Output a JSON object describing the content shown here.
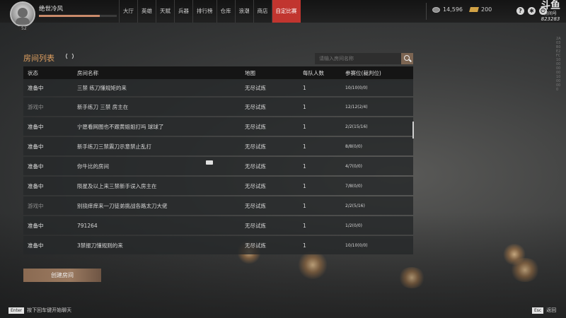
{
  "player": {
    "name": "绝世冷风",
    "level": "52",
    "hp_fraction": 0.78
  },
  "nav": [
    {
      "label": "大厅",
      "active": false
    },
    {
      "label": "英雄",
      "active": false
    },
    {
      "label": "天赋",
      "active": false
    },
    {
      "label": "兵器",
      "active": false
    },
    {
      "label": "排行榜",
      "active": false
    },
    {
      "label": "仓库",
      "active": false
    },
    {
      "label": "浪潮",
      "active": false
    },
    {
      "label": "商店",
      "active": false
    },
    {
      "label": "自定比赛",
      "active": true
    }
  ],
  "currency": {
    "silver": "14,596",
    "gold": "200"
  },
  "top_icons": [
    "help-icon",
    "settings-icon",
    "power-icon"
  ],
  "stream": {
    "logo": "斗鱼",
    "subtitle": "房间号",
    "room_id": "823283",
    "vertical_id": "2A03B0E2FC100000001000000"
  },
  "panel": {
    "title": "房间列表",
    "search_placeholder": "请输入房间名称",
    "columns": [
      "状态",
      "房间名称",
      "地图",
      "每队人数",
      "参赛位(裁判位)"
    ]
  },
  "rows": [
    {
      "status": "准备中",
      "state": "ready",
      "name": "三禁 练刀懂规矩的来",
      "map": "无尽试炼",
      "per_team": "1",
      "slots": "10/10(0/0)"
    },
    {
      "status": "游戏中",
      "state": "game",
      "name": "新手练刀  三禁  房主在",
      "map": "无尽试炼",
      "per_team": "1",
      "slots": "12/12(2/4)"
    },
    {
      "status": "准备中",
      "state": "ready",
      "name": "宁愿看网图也不跟黄姐姐打吗  球球了",
      "map": "无尽试炼",
      "per_team": "1",
      "slots": "2/2(15/16)"
    },
    {
      "status": "准备中",
      "state": "ready",
      "name": "新手练刀三禁震刀示意禁止乱打",
      "map": "无尽试炼",
      "per_team": "1",
      "slots": "8/8(0/0)"
    },
    {
      "status": "准备中",
      "state": "ready",
      "name": "你牛比的房间",
      "map": "无尽试炼",
      "per_team": "1",
      "slots": "4/7(0/0)",
      "chat": true
    },
    {
      "status": "准备中",
      "state": "ready",
      "name": "陨星及以上来三禁新手误入房主在",
      "map": "无尽试炼",
      "per_team": "1",
      "slots": "7/8(0/0)"
    },
    {
      "status": "游戏中",
      "state": "game",
      "name": "别挠痒痒来一刀徒弟挑战各路太刀大佬",
      "map": "无尽试炼",
      "per_team": "1",
      "slots": "2/2(5/16)"
    },
    {
      "status": "准备中",
      "state": "ready",
      "name": "791264",
      "map": "无尽试炼",
      "per_team": "1",
      "slots": "1/2(0/0)"
    },
    {
      "status": "准备中",
      "state": "ready",
      "name": "3禁振刀懂规则的来",
      "map": "无尽试炼",
      "per_team": "1",
      "slots": "10/10(0/0)"
    }
  ],
  "create_button": "创建房间",
  "footer": {
    "enter_key": "Enter",
    "enter_hint": "按下回车键开始聊天",
    "esc_key": "Esc",
    "esc_hint": "返回"
  }
}
